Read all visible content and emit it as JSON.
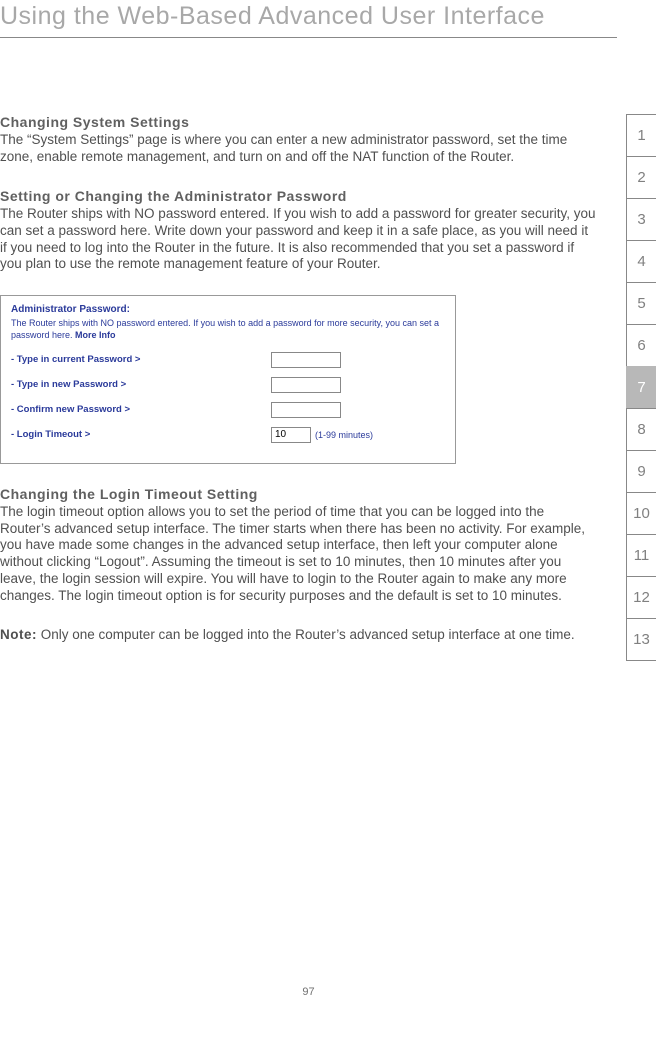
{
  "page_title": "Using the Web-Based Advanced User Interface",
  "page_number": "97",
  "tabs": [
    "1",
    "2",
    "3",
    "4",
    "5",
    "6",
    "7",
    "8",
    "9",
    "10",
    "11",
    "12",
    "13"
  ],
  "active_tab_index": 6,
  "sections": {
    "s1": {
      "heading": "Changing System Settings",
      "body": "The “System Settings” page is where you can enter a new administrator password, set the time zone, enable remote management, and turn on and off the NAT function of the Router."
    },
    "s2": {
      "heading": "Setting or Changing the Administrator Password",
      "body": "The Router ships with NO password entered. If you wish to add a password for greater security, you can set a password here. Write down your password and keep it in a safe place, as you will need it if you need to log into the Router in the future. It is also recommended that you set a password if you plan to use the remote management feature of your Router."
    },
    "s3": {
      "heading": "Changing the Login Timeout Setting",
      "body": "The login timeout option allows you to set the period of time that you can be logged into the Router’s advanced setup interface. The timer starts when there has been no activity. For example, you have made some changes in the advanced setup interface, then left your computer alone without clicking “Logout”. Assuming the timeout is set to 10 minutes, then 10 minutes after you leave, the login session will expire. You will have to login to the Router again to make any more changes. The login timeout option is for security purposes and the default is set to 10 minutes."
    },
    "note": {
      "label": "Note:",
      "body": " Only one computer can be logged into the Router’s advanced setup interface at one time."
    }
  },
  "screenshot": {
    "title": "Administrator Password:",
    "desc": "The Router ships with NO password entered. If you wish to add a password for more security, you can set a password here. ",
    "more_info": "More Info",
    "rows": {
      "r1": "- Type in current Password >",
      "r2": "- Type in new Password >",
      "r3": "- Confirm new Password >",
      "r4": "- Login Timeout >"
    },
    "timeout_value": "10",
    "timeout_suffix": "(1-99 minutes)"
  }
}
